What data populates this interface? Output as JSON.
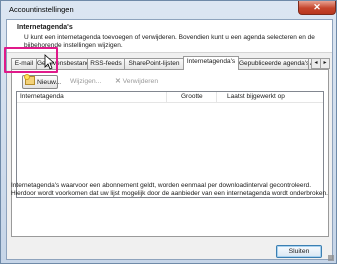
{
  "window": {
    "title": "Accountinstellingen",
    "close_glyph": "✕"
  },
  "header": {
    "title": "Internetagenda's",
    "description": "U kunt een internetagenda toevoegen of verwijderen. Bovendien kunt u een agenda selecteren en de bijbehorende instellingen wijzigen."
  },
  "tabs": [
    {
      "label": "E-mail",
      "active": false
    },
    {
      "label": "Gegevensbestanden",
      "active": false
    },
    {
      "label": "RSS-feeds",
      "active": false
    },
    {
      "label": "SharePoint-lijsten",
      "active": false
    },
    {
      "label": "Internetagenda's",
      "active": true
    },
    {
      "label": "Gepubliceerde agenda's",
      "active": false
    },
    {
      "label": "Ad",
      "active": false
    }
  ],
  "tab_scroll": {
    "left": "◂",
    "right": "▸"
  },
  "toolbar": {
    "new_label": "Nieuw...",
    "change_label": "Wijzigen...",
    "remove_label": "Verwijderen",
    "remove_glyph": "✕"
  },
  "list": {
    "columns": [
      "Internetagenda",
      "Grootte",
      "Laatst bijgewerkt op"
    ],
    "rows": []
  },
  "footer_text": "Internetagenda's waarvoor een abonnement geldt, worden eenmaal per downloadinterval gecontroleerd. Hierdoor wordt voorkomen dat uw lijst mogelijk door de aanbieder van een internetagenda wordt onderbroken.",
  "buttons": {
    "close_label": "Sluiten"
  },
  "colors": {
    "highlight": "#e0198a",
    "window_frame": "#6f8aa8",
    "close_red": "#c5452c"
  }
}
